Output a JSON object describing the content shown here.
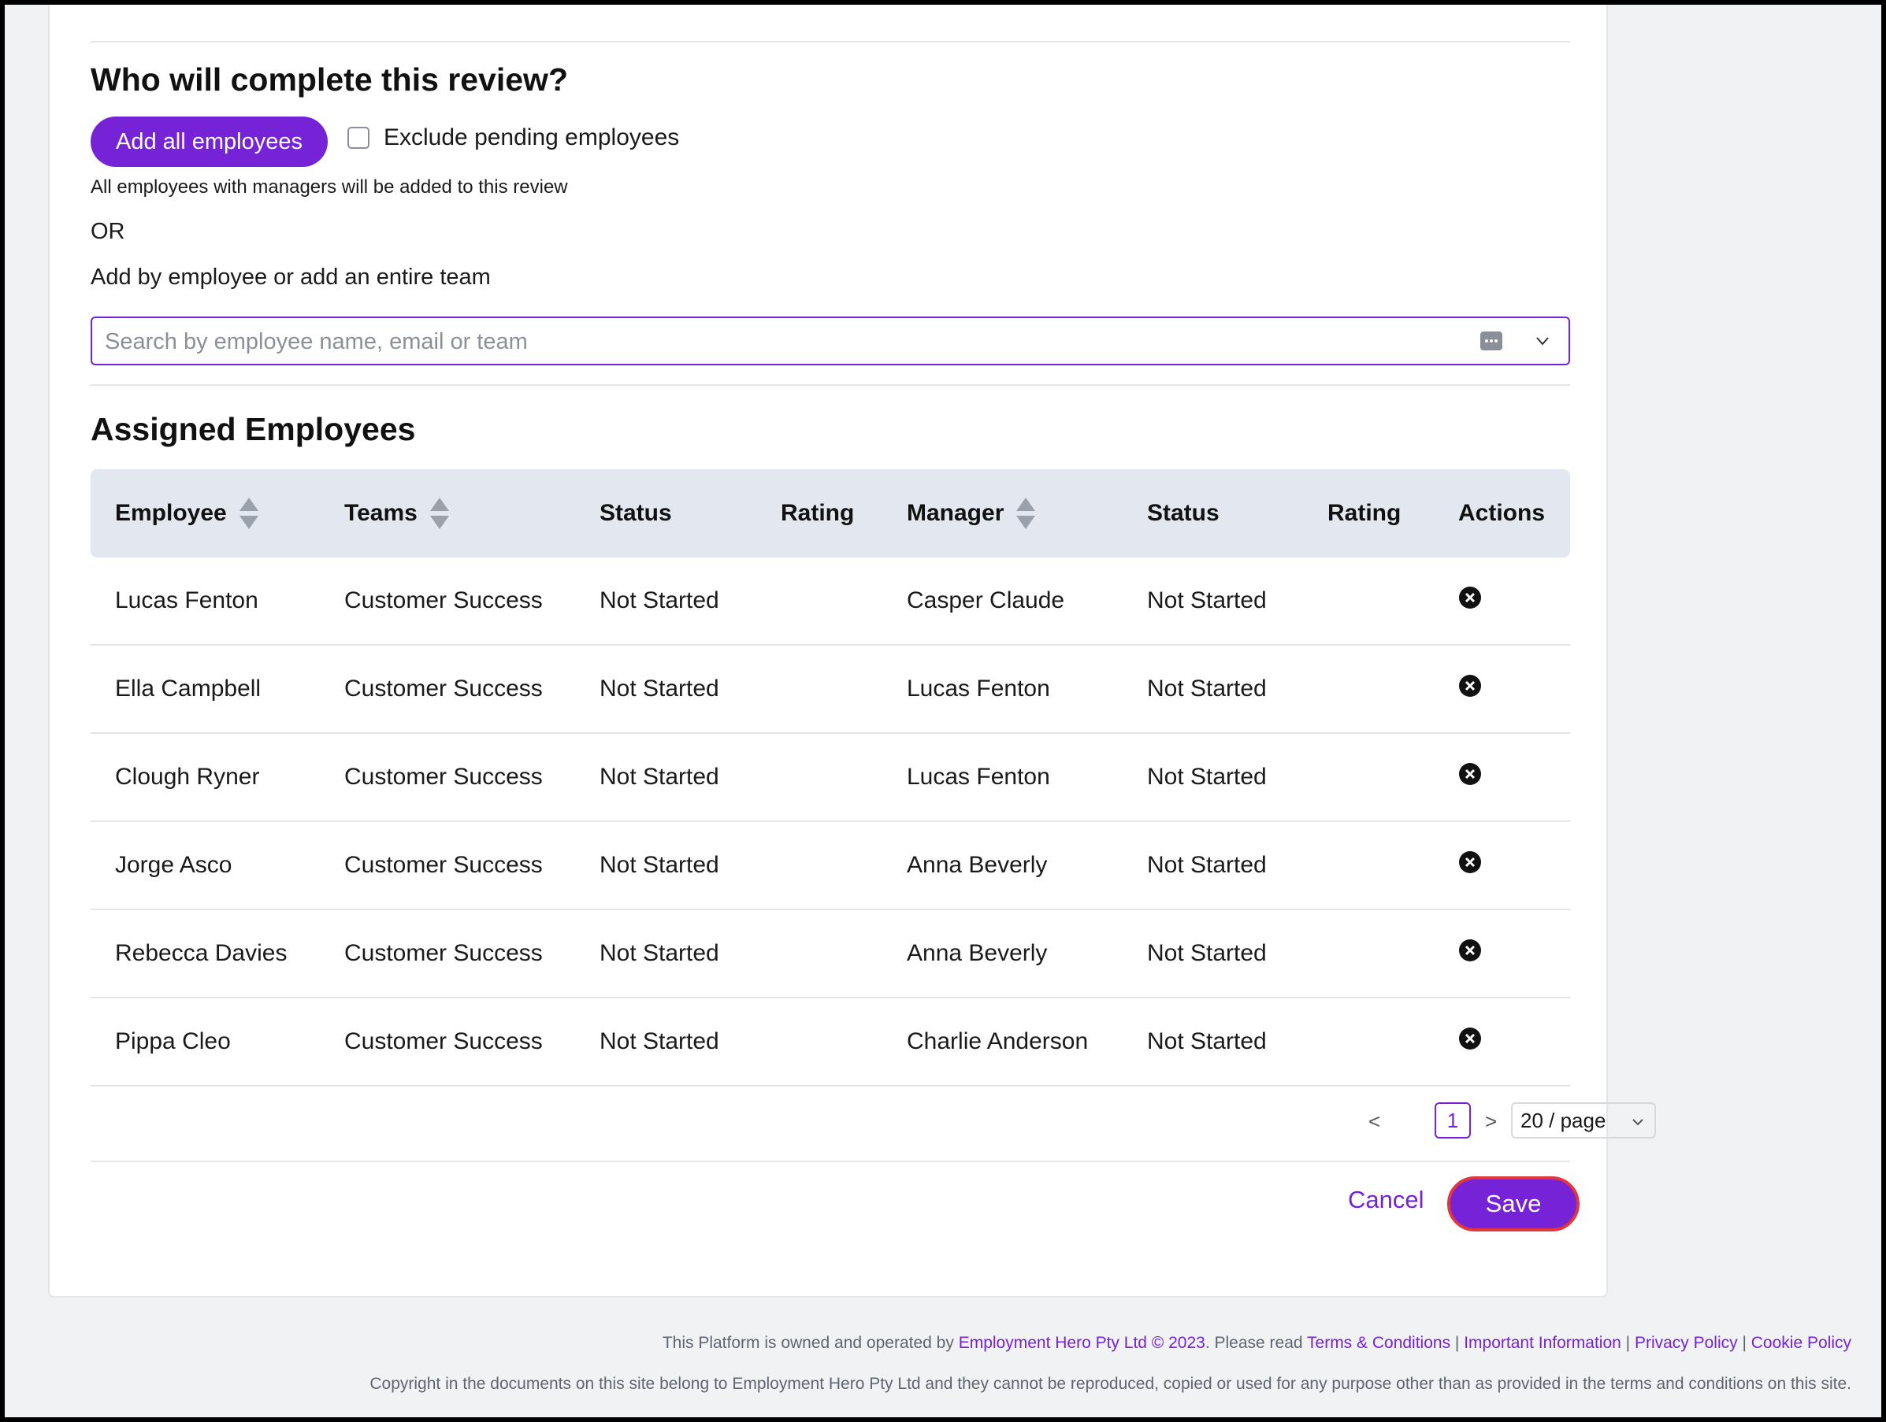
{
  "who": {
    "title": "Who will complete this review?",
    "add_all_label": "Add all employees",
    "exclude_label": "Exclude pending employees",
    "note": "All employees with managers will be added to this review",
    "or_text": "OR",
    "add_by_label": "Add by employee or add an entire team",
    "search_placeholder": "Search by employee name, email or team"
  },
  "assigned": {
    "title": "Assigned Employees",
    "columns": {
      "employee": "Employee",
      "teams": "Teams",
      "status": "Status",
      "rating": "Rating",
      "manager": "Manager",
      "manager_status": "Status",
      "manager_rating": "Rating",
      "actions": "Actions"
    },
    "rows": [
      {
        "employee": "Lucas Fenton",
        "team": "Customer Success",
        "status": "Not Started",
        "manager": "Casper Claude",
        "manager_status": "Not Started"
      },
      {
        "employee": "Ella Campbell",
        "team": "Customer Success",
        "status": "Not Started",
        "manager": "Lucas Fenton",
        "manager_status": "Not Started"
      },
      {
        "employee": "Clough Ryner",
        "team": "Customer Success",
        "status": "Not Started",
        "manager": "Lucas Fenton",
        "manager_status": "Not Started"
      },
      {
        "employee": "Jorge Asco",
        "team": "Customer Success",
        "status": "Not Started",
        "manager": "Anna Beverly",
        "manager_status": "Not Started"
      },
      {
        "employee": "Rebecca Davies",
        "team": "Customer Success",
        "status": "Not Started",
        "manager": "Anna Beverly",
        "manager_status": "Not Started"
      },
      {
        "employee": "Pippa Cleo",
        "team": "Customer Success",
        "status": "Not Started",
        "manager": "Charlie Anderson",
        "manager_status": "Not Started"
      }
    ]
  },
  "pagination": {
    "prev": "<",
    "next": ">",
    "current_page": "1",
    "page_size": "20 / page"
  },
  "actions": {
    "cancel_label": "Cancel",
    "save_label": "Save"
  },
  "footer": {
    "line1_prefix": "This Platform is owned and operated by ",
    "company_link": "Employment Hero Pty Ltd © 2023",
    "please_read": ". Please read ",
    "terms_link": "Terms & Conditions",
    "separator": " | ",
    "important_link": "Important Information",
    "privacy_link": "Privacy Policy",
    "cookie_link": "Cookie Policy",
    "line2": "Copyright in the documents on this site belong to Employment Hero Pty Ltd and they cannot be reproduced, copied or used for any purpose other than as provided in the terms and conditions on this site."
  },
  "colors": {
    "accent": "#7622d7",
    "save_border": "#e0373f",
    "table_header_bg": "#e3e8f0",
    "page_bg": "#f1f2f4"
  },
  "icons": [
    "keyboard-icon",
    "chevron-down-icon",
    "sort-icon",
    "remove-circle-icon"
  ]
}
